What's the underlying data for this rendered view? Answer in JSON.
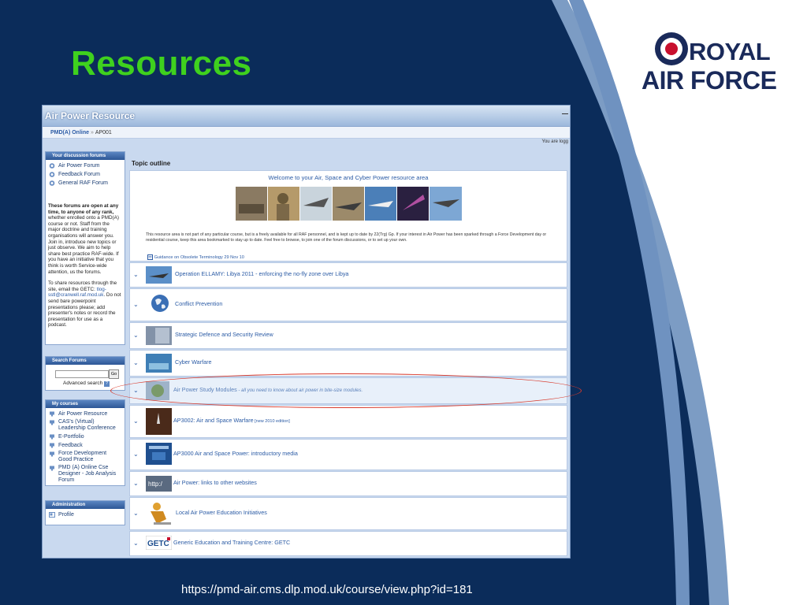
{
  "slide": {
    "title": "Resources",
    "url": "https://pmd-air.cms.dlp.mod.uk/course/view.php?id=181",
    "logo": {
      "line1": "ROYAL",
      "line2": "AIR FORCE"
    },
    "colors": {
      "background": "#0b2c5a",
      "title": "#3fd11e",
      "roundel_red": "#c8102e",
      "logo_text": "#1a2a5a"
    }
  },
  "page": {
    "site_title": "Air Power Resource",
    "breadcrumb": {
      "home": "PMD(A) Online",
      "separator": "»",
      "current": "AP001"
    },
    "logged_in": "You are logg"
  },
  "sidebar": {
    "forums": {
      "header": "Your discussion forums",
      "items": [
        "Air Power Forum",
        "Feedback Forum",
        "General RAF Forum"
      ],
      "intro_bold": "These forums are open at any time, to anyone of any rank,",
      "intro_rest": " whether enrolled onto a PMD(A) course or not. Staff from the major doctrine and training organisations will answer you. Join in, introduce new topics or just observe. We aim to help share best practice RAF-wide. If you have an initiative that you think is worth Service-wide attention, us the forums.",
      "share": "To share resources through the site, email the GETC:",
      "email": "tlog-sstl@cranwell.raf.mod.uk",
      "share_rest": ". Do not send bare powerpoint presentations please; add presenter's notes or record the presentation for use as a podcast."
    },
    "search": {
      "header": "Search Forums",
      "go": "Go",
      "advanced": "Advanced search"
    },
    "courses": {
      "header": "My courses",
      "items": [
        "Air Power Resource",
        "CAS's (Virtual) Leadership Conference",
        "E-Portfolio",
        "Feedback",
        "Force Development Good Practice",
        "PMD (A) Online Cse Designer - Job Analysis Forum"
      ]
    },
    "admin": {
      "header": "Administration",
      "items": [
        "Profile"
      ]
    }
  },
  "main": {
    "topic_title": "Topic outline",
    "welcome_title": "Welcome to your Air, Space and Cyber Power resource area",
    "welcome_text": "This resource area is not part of any particular course, but is a freely available for all RAF personnel, and is kept up to date by 22(Trg) Gp. If your interest in Air Power has been sparked through a Force Development day or residential course, keep this area bookmarked to stay up to date. Feel free to browse, to join one of the forum discussions, or to set up your own.",
    "guidance": "Guidance on Obsolete Terminology 29 Nov 10",
    "sections": [
      {
        "label": "Operation ELLAMY: Libya 2011 - enforcing the no-fly zone over Libya"
      },
      {
        "label": "Conflict Prevention"
      },
      {
        "label": "Strategic Defence and Security Review"
      },
      {
        "label": "Cyber Warfare"
      },
      {
        "label": "Air Power Study Modules",
        "note": " - all you need to know about air power in bite-size modules."
      },
      {
        "label": "AP3002: Air and Space Warfare",
        "note": " [new 2010 edition]"
      },
      {
        "label": "AP3000 Air and Space Power: introductory media"
      },
      {
        "label": "Air Power: links to other websites"
      },
      {
        "label": "Local Air Power Education Initiatives"
      },
      {
        "label": "Generic Education and Training Centre: GETC"
      }
    ]
  }
}
